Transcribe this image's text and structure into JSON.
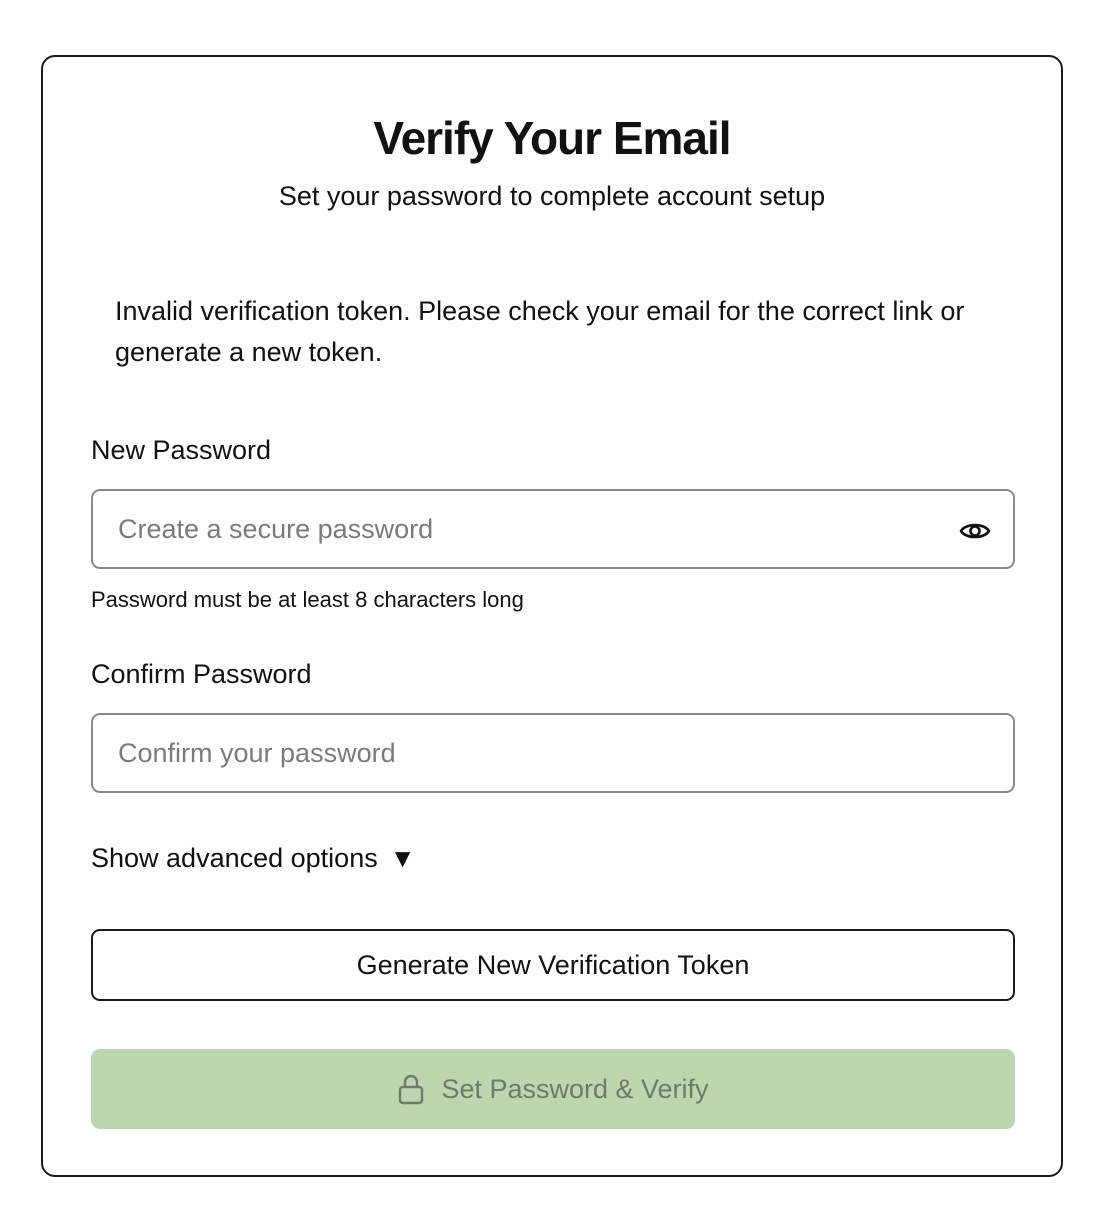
{
  "card": {
    "title": "Verify Your Email",
    "subtitle": "Set your password to complete account setup",
    "error_message": "Invalid verification token. Please check your email for the correct link or generate a new token."
  },
  "new_password": {
    "label": "New Password",
    "placeholder": "Create a secure password",
    "value": "",
    "hint": "Password must be at least 8 characters long",
    "toggle_icon": "eye-icon"
  },
  "confirm_password": {
    "label": "Confirm Password",
    "placeholder": "Confirm your password",
    "value": ""
  },
  "advanced": {
    "label": "Show advanced options",
    "indicator": "▼"
  },
  "buttons": {
    "generate_label": "Generate New Verification Token",
    "submit_label": "Set Password & Verify",
    "submit_icon": "lock-icon",
    "submit_disabled": true
  },
  "colors": {
    "submit_bg": "#bcd6ad",
    "submit_text": "#6f7a6a",
    "border": "#1a1a1a",
    "input_border": "#8a8a8a"
  }
}
